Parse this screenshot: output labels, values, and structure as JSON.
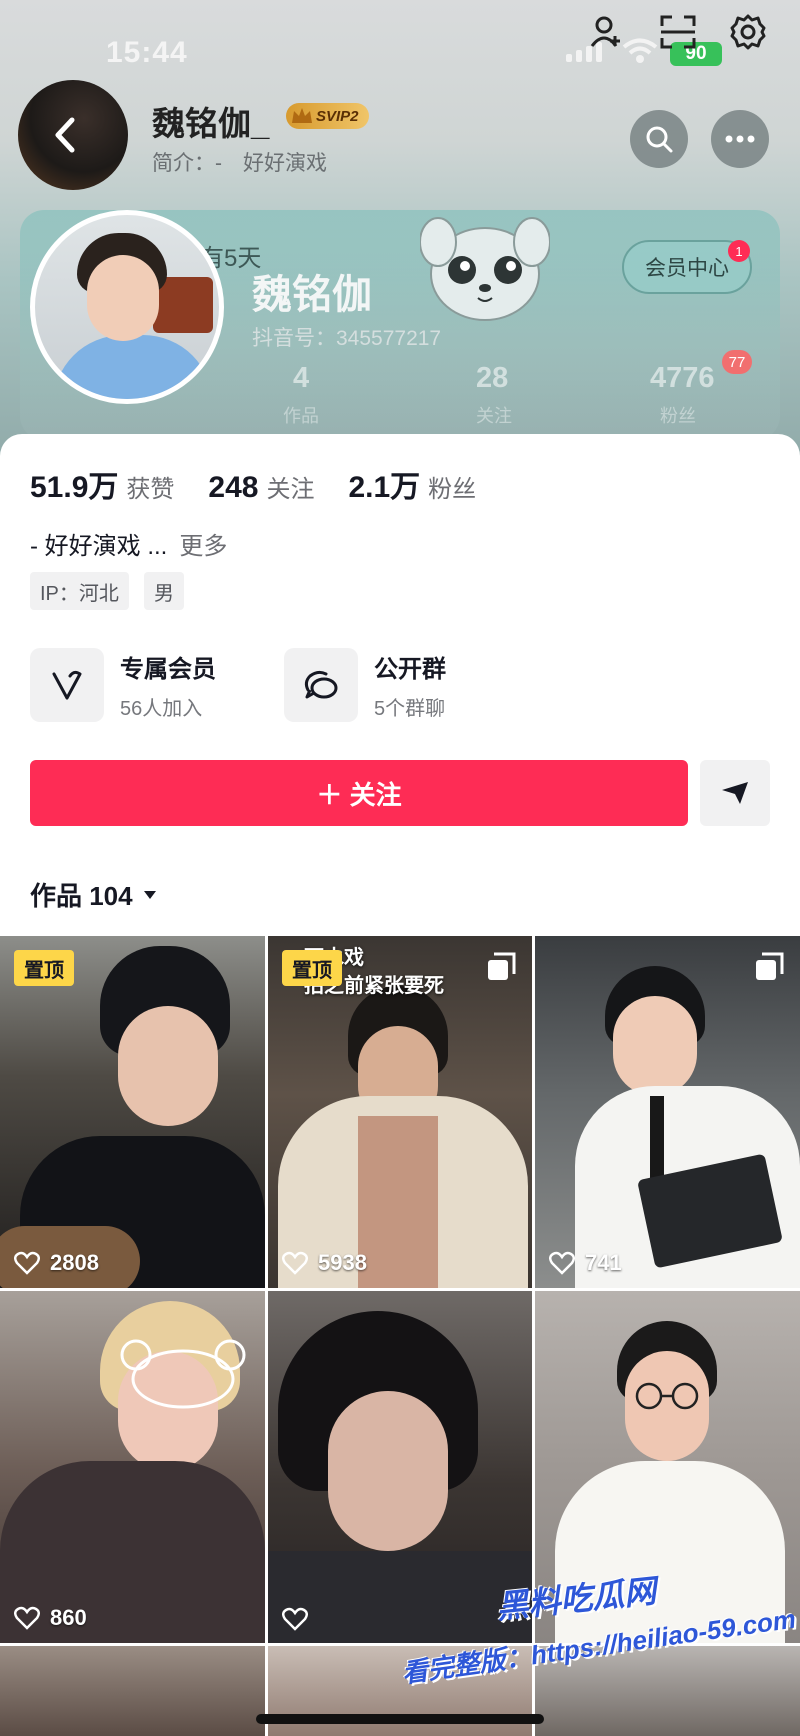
{
  "status_bar": {
    "time": "15:44",
    "battery": "90"
  },
  "header": {
    "nickname_top": "魏铭伽_",
    "vip_badge": "SVIP2",
    "bio_top": "简介：-　好好演戏"
  },
  "member_card": {
    "days_text": "有5天",
    "vip_center_label": "会员中心",
    "vip_center_badge": "1",
    "nickname": "魏铭伽",
    "douyin_id": "抖音号：345577217",
    "stats": [
      {
        "value": "4",
        "label": "作品"
      },
      {
        "value": "28",
        "label": "关注"
      },
      {
        "value": "4776",
        "label": "粉丝"
      }
    ],
    "fans_badge": "77"
  },
  "profile_stats": [
    {
      "value": "51.9万",
      "label": "获赞"
    },
    {
      "value": "248",
      "label": "关注"
    },
    {
      "value": "2.1万",
      "label": "粉丝"
    }
  ],
  "bio": {
    "text": "- 好好演戏 ...",
    "more": "更多"
  },
  "tags": [
    "IP：河北",
    "男"
  ],
  "features": [
    {
      "title": "专属会员",
      "subtitle": "56人加入",
      "icon": "heart-v-icon"
    },
    {
      "title": "公开群",
      "subtitle": "5个群聊",
      "icon": "chat-bubbles-icon"
    }
  ],
  "follow_button": "＋ 关注",
  "works_tab": {
    "label": "作品 104"
  },
  "videos": [
    {
      "pinned": "置顶",
      "likes": "2808",
      "multi": false
    },
    {
      "pinned": "置顶",
      "likes": "5938",
      "multi": true,
      "overlay": [
        "下水戏",
        "拍之前紧张要死"
      ]
    },
    {
      "pinned": "",
      "likes": "741",
      "multi": true
    },
    {
      "pinned": "",
      "likes": "860",
      "multi": false
    },
    {
      "pinned": "",
      "likes": "",
      "multi": false
    },
    {
      "pinned": "",
      "likes": "",
      "multi": false
    }
  ],
  "watermark": {
    "logo": "黑料吃瓜网",
    "url": "看完整版：https://heiliao-59.com"
  }
}
